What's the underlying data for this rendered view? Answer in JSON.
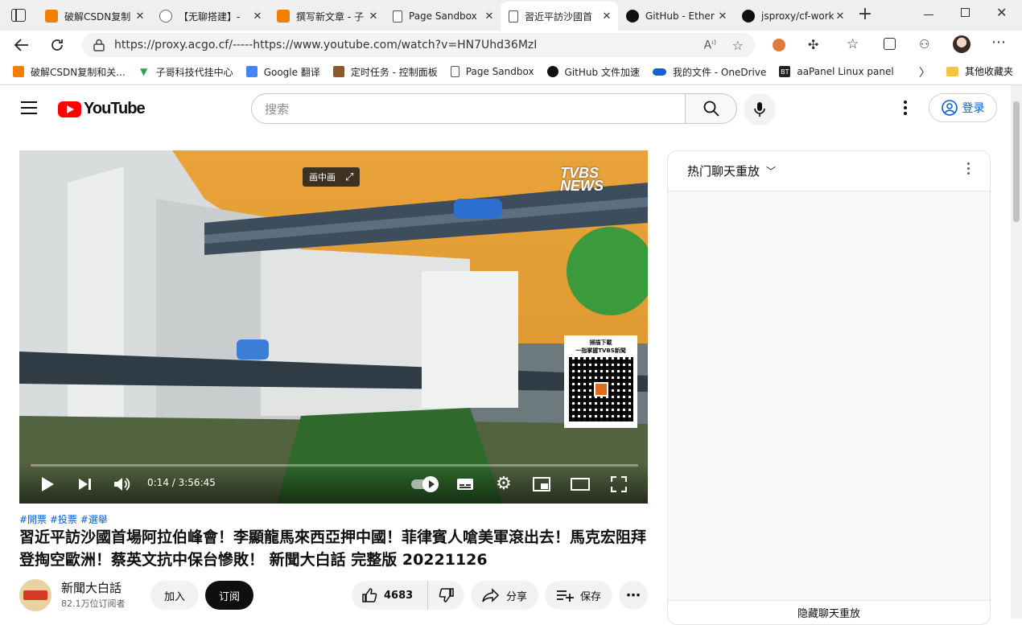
{
  "browser": {
    "tabs": [
      {
        "title": "破解CSDN复制",
        "icon": "blogger-icon",
        "color": "#f57d00"
      },
      {
        "title": "【无聊搭建】-",
        "icon": "user-icon",
        "color": "#666666"
      },
      {
        "title": "撰写新文章 - 子",
        "icon": "blogger-icon",
        "color": "#f57d00"
      },
      {
        "title": "Page Sandbox",
        "icon": "page-icon",
        "color": "#555555"
      },
      {
        "title": "習近平訪沙國首",
        "icon": "page-icon",
        "color": "#555555"
      },
      {
        "title": "GitHub - Ether",
        "icon": "github-icon",
        "color": "#111111"
      },
      {
        "title": "jsproxy/cf-work",
        "icon": "github-icon",
        "color": "#111111"
      }
    ],
    "url": "https://proxy.acgo.cf/-----https://www.youtube.com/watch?v=HN7Uhd36MzI",
    "bookmarks": [
      {
        "label": "破解CSDN复制和关...",
        "icon": "blogger-icon",
        "color": "#f57d00"
      },
      {
        "label": "子哥科技代挂中心",
        "icon": "v-icon",
        "color": "#2aa54a"
      },
      {
        "label": "Google 翻译",
        "icon": "google-translate-icon",
        "color": "#4285f4"
      },
      {
        "label": "定时任务 - 控制面板",
        "icon": "cow-icon",
        "color": "#8a5a2b"
      },
      {
        "label": "Page Sandbox",
        "icon": "page-icon",
        "color": "#555555"
      },
      {
        "label": "GitHub 文件加速",
        "icon": "github-icon",
        "color": "#111111"
      },
      {
        "label": "我的文件 - OneDrive",
        "icon": "onedrive-icon",
        "color": "#0a64d3"
      },
      {
        "label": "aaPanel Linux panel",
        "icon": "bt-icon",
        "color": "#222222"
      }
    ],
    "other_bookmarks": "其他收藏夹"
  },
  "youtube": {
    "logo_text": "YouTube",
    "search_placeholder": "搜索",
    "login_label": "登录",
    "player": {
      "pip_label": "画中画",
      "time": "0:14 / 3:56:45",
      "progress_fraction": 0.001,
      "watermark": "TVBS NEWS",
      "qr_caption_1": "掃描下載",
      "qr_caption_2": "一指掌握TVBS新聞"
    },
    "tags": "#開票 #投票 #選舉",
    "title": "習近平訪沙國首場阿拉伯峰會！李顯龍馬來西亞押中國！菲律賓人嗆美軍滾出去！馬克宏阻拜登掏空歐洲！蔡英文抗中保台慘敗！ 新聞大白話 完整版 20221126",
    "channel": {
      "name": "新聞大白話",
      "subscribers": "82.1万位订阅者"
    },
    "buttons": {
      "join": "加入",
      "subscribe": "订阅",
      "likes": "4683",
      "share": "分享",
      "save": "保存"
    },
    "chat": {
      "header": "热门聊天重放",
      "footer": "隐藏聊天重放"
    }
  }
}
